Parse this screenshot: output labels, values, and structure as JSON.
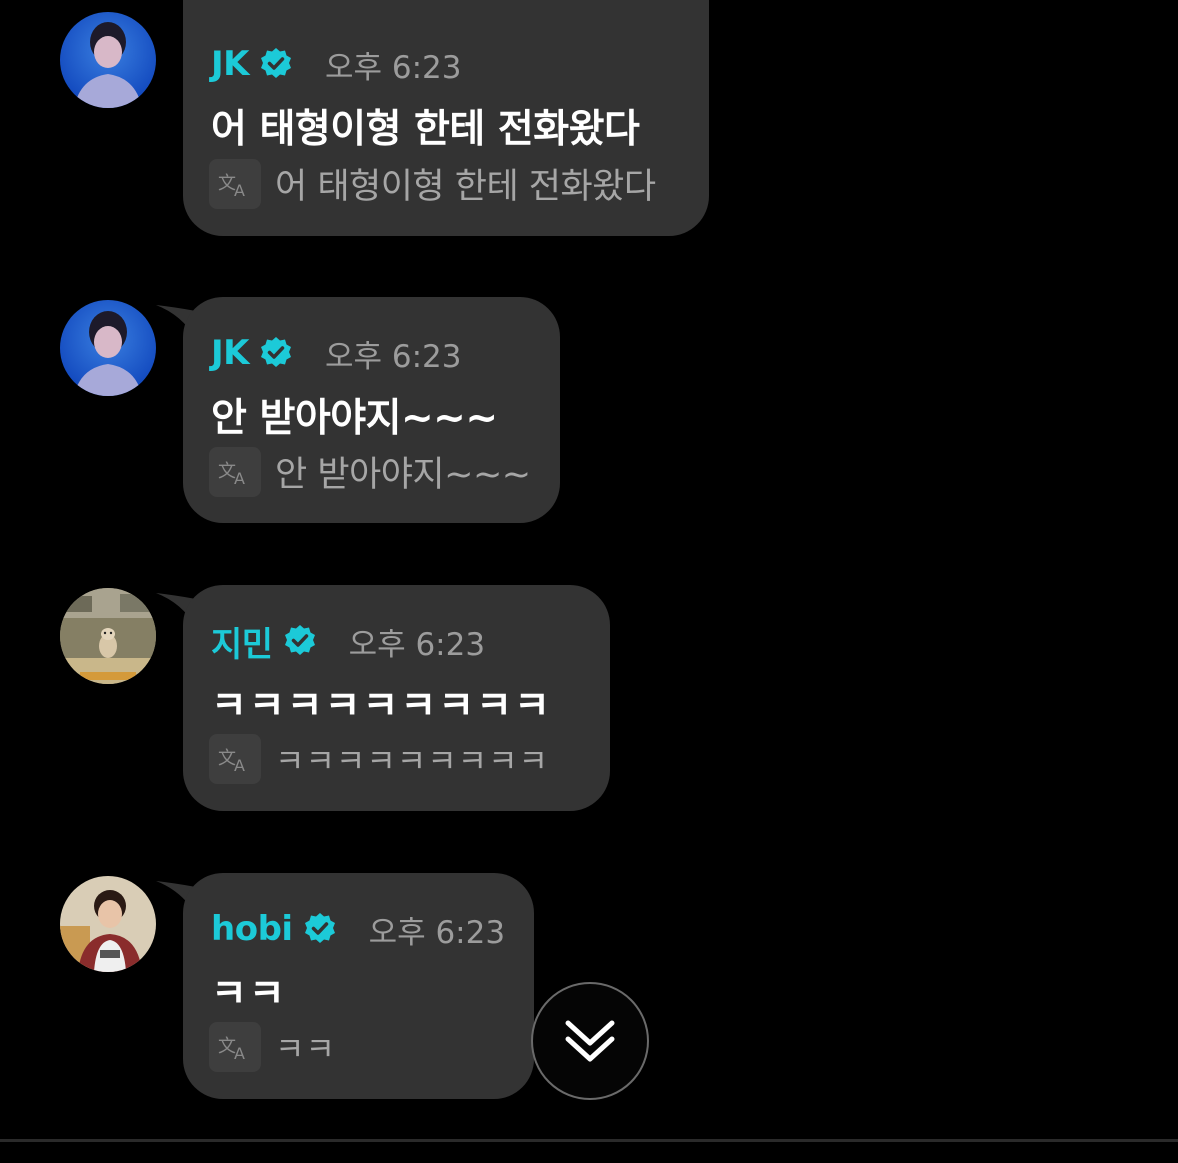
{
  "messages": [
    {
      "name": "JK",
      "time": "오후 6:23",
      "text": "어 태형이형 한테 전화왔다",
      "translation": "어 태형이형 한테 전화왔다",
      "avatar": "jk-avatar",
      "verified": true
    },
    {
      "name": "JK",
      "time": "오후 6:23",
      "text": "안 받아야지~~~",
      "translation": "안 받아야지~~~",
      "avatar": "jk-avatar",
      "verified": true
    },
    {
      "name": "지민",
      "time": "오후 6:23",
      "text": "ㅋㅋㅋㅋㅋㅋㅋㅋㅋ",
      "translation": "ㅋㅋㅋㅋㅋㅋㅋㅋㅋ",
      "avatar": "jimin-avatar",
      "verified": true
    },
    {
      "name": "hobi",
      "time": "오후 6:23",
      "text": "ㅋㅋ",
      "translation": "ㅋㅋ",
      "avatar": "hobi-avatar",
      "verified": true
    }
  ],
  "icons": {
    "verified": "verified-badge-icon",
    "translate": "translate-icon",
    "scroll_down": "double-chevron-down-icon"
  },
  "colors": {
    "background": "#000000",
    "bubble": "#333333",
    "name": "#1ccad8",
    "time": "#9c9c9c",
    "message_text": "#ffffff",
    "translation_text": "#a6a6a6"
  }
}
